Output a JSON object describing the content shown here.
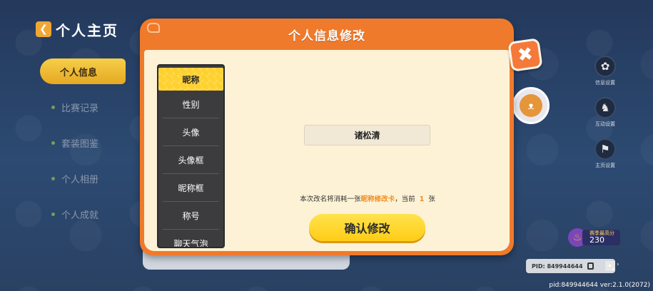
{
  "page": {
    "title": "个人主页",
    "nav": [
      "个人信息",
      "比赛记录",
      "套装图鉴",
      "个人相册",
      "个人成就"
    ]
  },
  "tools": [
    {
      "icon": "gear-icon",
      "glyph": "✿",
      "label": "信息设置"
    },
    {
      "icon": "pose-icon",
      "glyph": "♞",
      "label": "互动设置"
    },
    {
      "icon": "flag-icon",
      "glyph": "⚑",
      "label": "主页设置"
    }
  ],
  "rank": {
    "name": "赛季最高分",
    "score": "230"
  },
  "pid_bar": {
    "pid": "PID: 849944644"
  },
  "version": "pid:849944644 ver:2.1.0(2072)",
  "modal": {
    "title": "个人信息修改",
    "close_glyph": "✖",
    "tabs": [
      "昵称",
      "性别",
      "头像",
      "头像框",
      "昵称框",
      "称号",
      "聊天气泡"
    ],
    "active_tab": "昵称",
    "nickname_value": "诸松清",
    "notice_prefix": "本次改名将消耗一张",
    "notice_card": "昵称修改卡",
    "notice_middle": "，当前",
    "notice_count": "1",
    "notice_suffix": "张",
    "confirm_label": "确认修改"
  },
  "colors": {
    "modal_orange": "#f07a2b",
    "body_cream": "#fdf2d6",
    "accent_yellow": "#ffd12e",
    "highlight_orange": "#f08c1c",
    "background_navy": "#24395c"
  }
}
